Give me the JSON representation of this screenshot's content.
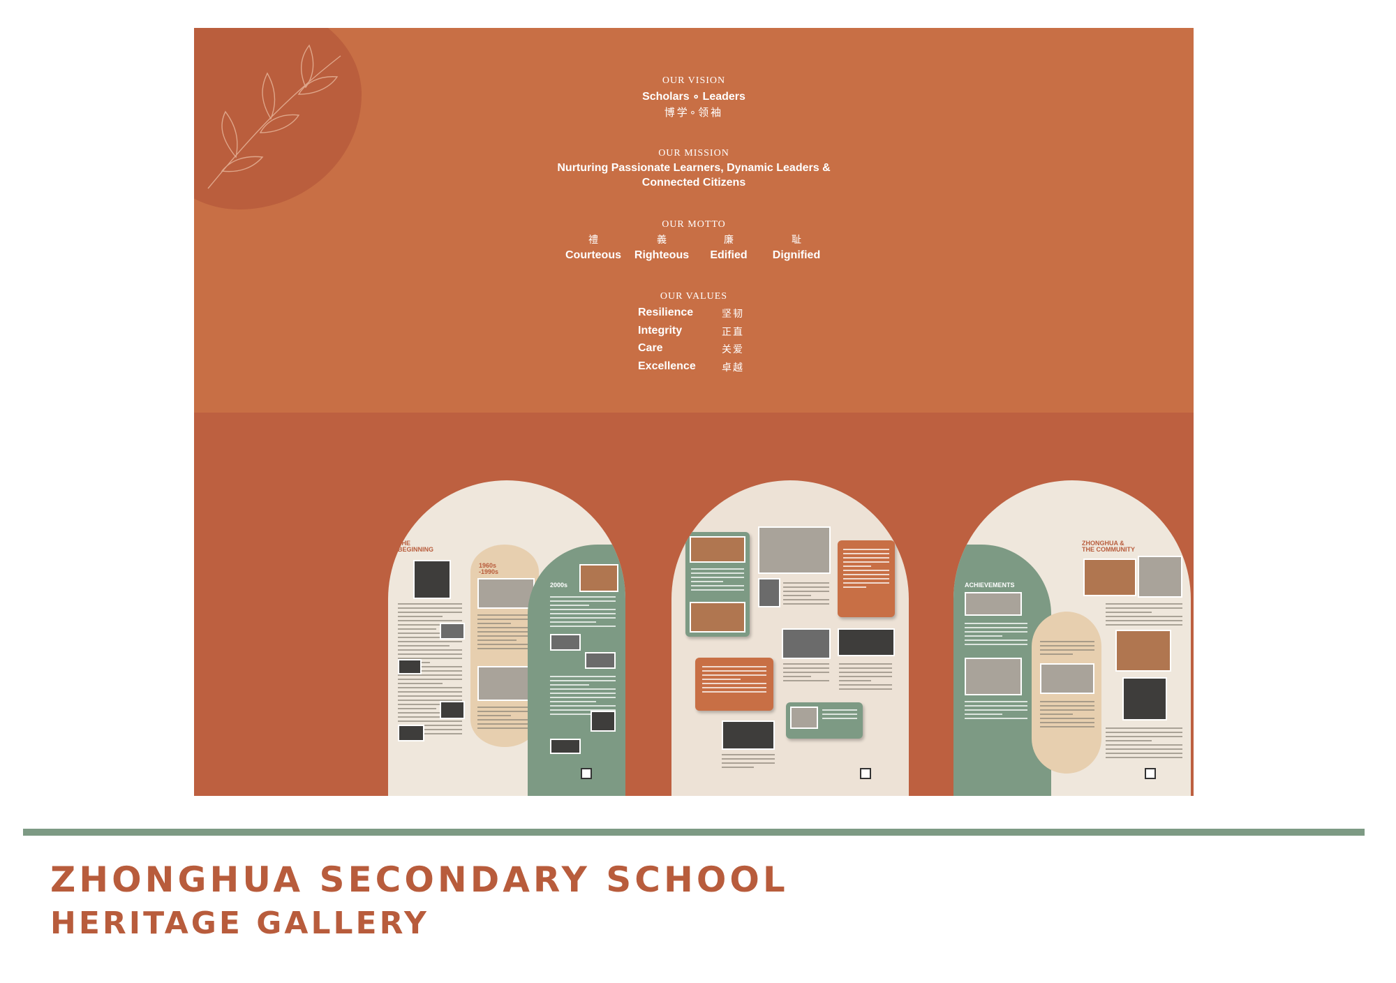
{
  "vision": {
    "heading": "OUR VISION",
    "line_en": "Scholars ∘ Leaders",
    "line_zh": "博学∘领袖"
  },
  "mission": {
    "heading": "OUR MISSION",
    "line1": "Nurturing Passionate Learners, Dynamic Leaders &",
    "line2": "Connected Citizens"
  },
  "motto": {
    "heading": "OUR MOTTO",
    "items": [
      {
        "zh": "禮",
        "en": "Courteous"
      },
      {
        "zh": "義",
        "en": "Righteous"
      },
      {
        "zh": "廉",
        "en": "Edified"
      },
      {
        "zh": "耻",
        "en": "Dignified"
      }
    ]
  },
  "values": {
    "heading": "OUR VALUES",
    "items": [
      {
        "en": "Resilience",
        "zh": "坚韧"
      },
      {
        "en": "Integrity",
        "zh": "正直"
      },
      {
        "en": "Care",
        "zh": "关爱"
      },
      {
        "en": "Excellence",
        "zh": "卓越"
      }
    ]
  },
  "panels": {
    "left": {
      "title_line1": "THE",
      "title_line2": "BEGINNING",
      "era1": "1960s",
      "era2": "-1990s",
      "era3": "2000s"
    },
    "right": {
      "title_line1": "ZHONGHUA &",
      "title_line2": "THE COMMUNITY",
      "section": "ACHIEVEMENTS"
    }
  },
  "footer": {
    "title": "ZHONGHUA SECONDARY SCHOOL",
    "subtitle": "HERITAGE GALLERY"
  },
  "colors": {
    "board": "#c86f45",
    "board_bottom": "#bd6040",
    "accent_green": "#7d9a84",
    "cream": "#efe7dc",
    "title_rust": "#b85c3c"
  }
}
